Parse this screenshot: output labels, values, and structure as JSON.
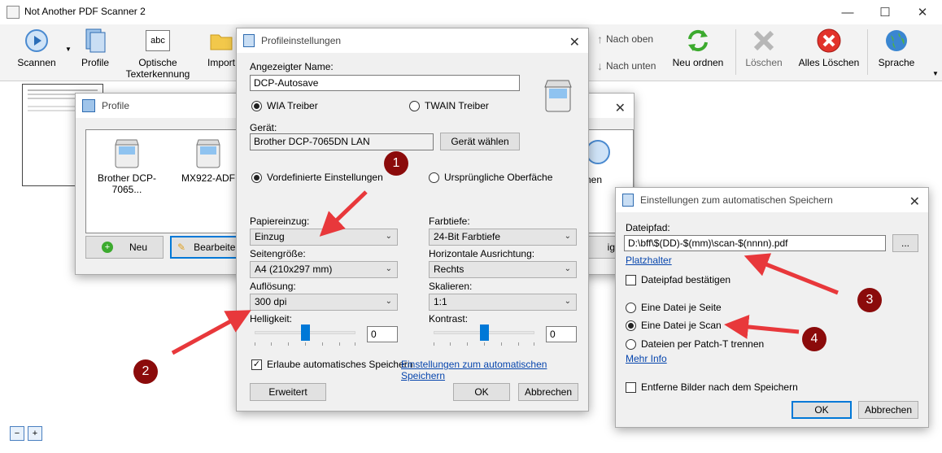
{
  "app": {
    "title": "Not Another PDF Scanner 2"
  },
  "toolbar": {
    "scan": "Scannen",
    "profile": "Profile",
    "ocr": "Optische Texterkennung",
    "ocr_icon_text": "abc",
    "import": "Import",
    "move_up": "Nach oben",
    "move_down": "Nach unten",
    "reorder": "Neu ordnen",
    "delete": "Löschen",
    "delete_all": "Alles Löschen",
    "language": "Sprache"
  },
  "profiles_dialog": {
    "title": "Profile",
    "items": [
      "Brother DCP-7065...",
      "MX922-ADF"
    ],
    "partial_text": "nen",
    "new_btn": "Neu",
    "edit_btn": "Bearbeiten",
    "partial_right_btn": "ig"
  },
  "profile_settings": {
    "title": "Profileinstellungen",
    "display_name_label": "Angezeigter Name:",
    "display_name_value": "DCP-Autosave",
    "wia": "WIA Treiber",
    "twain": "TWAIN Treiber",
    "device_label": "Gerät:",
    "device_value": "Brother DCP-7065DN LAN",
    "choose_device": "Gerät wählen",
    "predefined": "Vordefinierte Einstellungen",
    "native_ui": "Ursprüngliche Oberfäche",
    "paper_source_label": "Papiereinzug:",
    "paper_source_value": "Einzug",
    "bit_depth_label": "Farbtiefe:",
    "bit_depth_value": "24-Bit Farbtiefe",
    "page_size_label": "Seitengröße:",
    "page_size_value": "A4 (210x297 mm)",
    "h_align_label": "Horizontale Ausrichtung:",
    "h_align_value": "Rechts",
    "resolution_label": "Auflösung:",
    "resolution_value": "300 dpi",
    "scale_label": "Skalieren:",
    "scale_value": "1:1",
    "brightness_label": "Helligkeit:",
    "brightness_value": "0",
    "contrast_label": "Kontrast:",
    "contrast_value": "0",
    "autosave_check": "Erlaube automatisches Speichern",
    "autosave_link": "Einstellungen zum automatischen Speichern",
    "advanced_btn": "Erweitert",
    "ok_btn": "OK",
    "cancel_btn": "Abbrechen"
  },
  "autosave": {
    "title": "Einstellungen zum automatischen Speichern",
    "path_label": "Dateipfad:",
    "path_value": "D:\\bff\\$(DD)-$(mm)\\scan-$(nnnn).pdf",
    "browse_btn": "...",
    "placeholders_link": "Platzhalter",
    "confirm_path": "Dateipfad bestätigen",
    "one_per_page": "Eine Datei je Seite",
    "one_per_scan": "Eine Datei je Scan",
    "patch_t": "Dateien per Patch-T trennen",
    "more_info": "Mehr Info",
    "remove_images": "Entferne Bilder nach dem Speichern",
    "ok_btn": "OK",
    "cancel_btn": "Abbrechen"
  },
  "annotations": [
    "1",
    "2",
    "3",
    "4"
  ],
  "colors": {
    "arrow": "#e8383b",
    "badge": "#8b0b0b",
    "accent": "#0078d7"
  }
}
